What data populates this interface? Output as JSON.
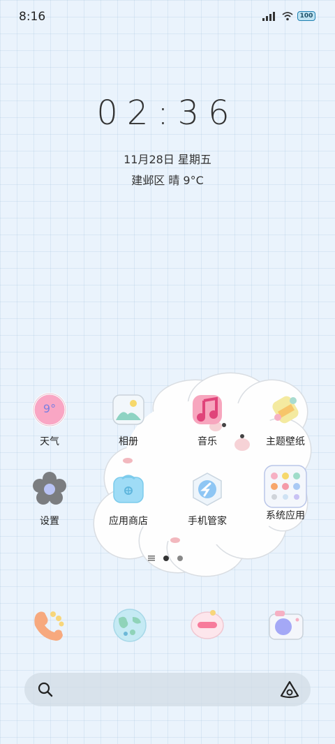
{
  "status_bar": {
    "time": "8:16",
    "battery": "100"
  },
  "lockscreen": {
    "clock": "02:36",
    "date": "11月28日 星期五",
    "weather": "建邺区 晴 9°C"
  },
  "apps_row1": [
    {
      "label": "天气",
      "icon": "weather-icon",
      "icon_text": "9°"
    },
    {
      "label": "相册",
      "icon": "gallery-icon"
    },
    {
      "label": "音乐",
      "icon": "music-icon"
    },
    {
      "label": "主题壁纸",
      "icon": "themes-icon"
    }
  ],
  "apps_row2": [
    {
      "label": "设置",
      "icon": "settings-icon"
    },
    {
      "label": "应用商店",
      "icon": "app-store-icon"
    },
    {
      "label": "手机管家",
      "icon": "security-icon"
    },
    {
      "label": "系统应用",
      "icon": "system-apps-folder-icon"
    }
  ],
  "page_indicator": {
    "pages": 2,
    "current": 1
  },
  "dock": [
    {
      "icon": "phone-icon"
    },
    {
      "icon": "browser-icon"
    },
    {
      "icon": "messages-icon"
    },
    {
      "icon": "camera-icon"
    }
  ],
  "colors": {
    "background": "#eaf3fc",
    "grid": "#c9dcea",
    "text": "#222222"
  }
}
